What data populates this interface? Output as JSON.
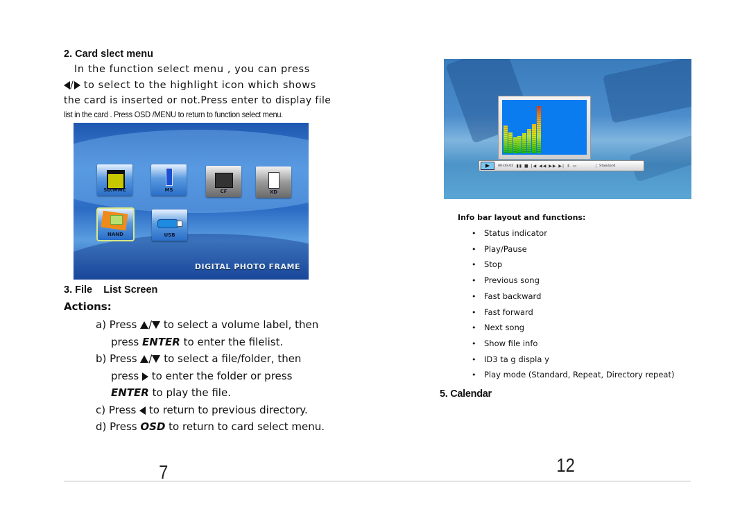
{
  "left_page": {
    "section2_heading": "2. Card slect menu",
    "para_line1": "In the function select menu , you can press",
    "para_line2_icons": [
      "left-arrow",
      "right-arrow"
    ],
    "para_line2_text": " to select to the highlight icon which shows",
    "para_line3": "the card is inserted or not.Press enter to display file",
    "para_line4": "list in the card . Press OSD /MENU to  return to  function select menu.",
    "card_menu_screenshot": {
      "tiles": [
        {
          "label": "SD/MMC",
          "icon": "sd-card-icon",
          "style": "blue",
          "selected": false
        },
        {
          "label": "MS",
          "icon": "memory-stick-icon",
          "style": "blue",
          "selected": false
        },
        {
          "label": "CF",
          "icon": "cf-card-icon",
          "style": "gray",
          "selected": false
        },
        {
          "label": "XD",
          "icon": "xd-card-icon",
          "style": "gray",
          "selected": false
        },
        {
          "label": "NAND",
          "icon": "nand-icon",
          "style": "blue",
          "selected": true
        },
        {
          "label": "USB",
          "icon": "usb-drive-icon",
          "style": "blue",
          "selected": false
        }
      ],
      "brand_text": "DIGITAL PHOTO FRAME"
    },
    "section3_heading": "3. File    List Screen",
    "actions_heading": "Actions:",
    "actions": {
      "a_prefix": "a) Press ",
      "a_text": " to select a volume label, then",
      "a2_pre": "press ",
      "a2_bold": "ENTER",
      "a2_post": " to enter the filelist.",
      "b_prefix": "b) Press ",
      "b_text": " to select a file/folder, then",
      "b2_pre": "press ",
      "b2_post": " to enter the folder or press",
      "b3_bold": "ENTER",
      "b3_post": " to play the file.",
      "c_prefix": "c) Press ",
      "c_post": " to return to previous directory.",
      "d_prefix": "d) Press ",
      "d_bold": "OSD",
      "d_post": " to return to card select menu."
    },
    "page_number": "7"
  },
  "right_page": {
    "music_screenshot": {
      "time": "00:00:05",
      "controls": "▮▮ ■ |◀ ◀◀ ▶▶ ▶| ⇕ ▭",
      "play_mode": "Standard",
      "spectrum_levels": [
        0.55,
        0.42,
        0.32,
        0.35,
        0.4,
        0.48,
        0.58,
        0.95
      ]
    },
    "info_heading": "Info bar layout and functions:",
    "bullets": [
      "Status indicator",
      "Play/Pause",
      "Stop",
      "Previous song",
      "Fast backward",
      "Fast forward",
      "Next song",
      "Show file info",
      "ID3 ta g displa y",
      "Play mode (Standard, Repeat, Directory repeat)"
    ],
    "bullet_char": "•",
    "section5_heading": "5. Calendar",
    "page_number": "12"
  }
}
